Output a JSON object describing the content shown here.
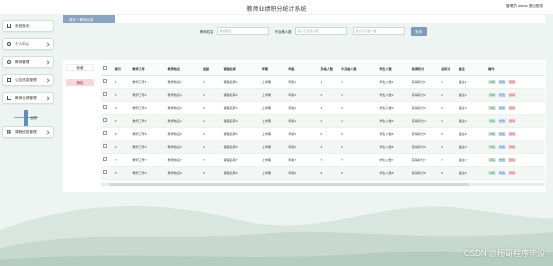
{
  "app": {
    "title": "教师业绩积分统计系统",
    "user_info": "管理员 admin  退出登录"
  },
  "sidebar": {
    "items": [
      {
        "label": "系统首页",
        "icon": "home-icon"
      },
      {
        "label": "个人中心",
        "icon": "user-icon"
      },
      {
        "label": "教师管理",
        "icon": "person-icon"
      },
      {
        "label": "公告信息管理",
        "icon": "book-icon"
      },
      {
        "label": "教师业绩管理",
        "icon": "chart-icon"
      },
      {
        "label": "课程信息管理",
        "icon": "grid-icon"
      }
    ],
    "slider_text": "业绩"
  },
  "breadcrumb": {
    "home": "首页",
    "current": "教师业绩"
  },
  "search": {
    "f1_label": "教师姓名",
    "f1_placeholder": "教师姓名",
    "f2_label": "不及格人数",
    "f2_placeholder": "最小不及格人数",
    "f3_placeholder": "最大不及格人数",
    "button": "查询"
  },
  "actions": {
    "add": "新增",
    "delete": "删除"
  },
  "table": {
    "headers": [
      "",
      "索引",
      "教师工号",
      "教师姓名",
      "班级",
      "课程名称",
      "学期",
      "年级",
      "及格人数",
      "不及格人数",
      "学生人数",
      "获得积分",
      "总积分",
      "备注",
      "操作"
    ],
    "row_actions": [
      "详情",
      "修改",
      "删除"
    ],
    "rows": [
      [
        "1",
        "教师工号1",
        "教师姓名1",
        "1",
        "课程名称1",
        "上学期",
        "年级1",
        "1",
        "1",
        "学生人数1",
        "获得积分1",
        "1",
        "备注1"
      ],
      [
        "2",
        "教师工号2",
        "教师姓名2",
        "2",
        "课程名称2",
        "上学期",
        "年级2",
        "2",
        "2",
        "学生人数2",
        "获得积分2",
        "2",
        "备注2"
      ],
      [
        "3",
        "教师工号3",
        "教师姓名3",
        "3",
        "课程名称3",
        "上学期",
        "年级3",
        "3",
        "3",
        "学生人数3",
        "获得积分3",
        "3",
        "备注3"
      ],
      [
        "4",
        "教师工号4",
        "教师姓名4",
        "4",
        "课程名称4",
        "上学期",
        "年级4",
        "4",
        "4",
        "学生人数4",
        "获得积分4",
        "4",
        "备注4"
      ],
      [
        "5",
        "教师工号5",
        "教师姓名5",
        "5",
        "课程名称5",
        "上学期",
        "年级5",
        "5",
        "5",
        "学生人数5",
        "获得积分5",
        "5",
        "备注5"
      ],
      [
        "6",
        "教师工号6",
        "教师姓名6",
        "6",
        "课程名称6",
        "上学期",
        "年级6",
        "6",
        "6",
        "学生人数6",
        "获得积分6",
        "6",
        "备注6"
      ],
      [
        "7",
        "教师工号7",
        "教师姓名7",
        "7",
        "课程名称7",
        "上学期",
        "年级7",
        "7",
        "7",
        "学生人数7",
        "获得积分7",
        "7",
        "备注7"
      ],
      [
        "8",
        "教师工号8",
        "教师姓名8",
        "8",
        "课程名称8",
        "上学期",
        "年级8",
        "8",
        "8",
        "学生人数8",
        "获得积分8",
        "8",
        "备注8"
      ]
    ]
  },
  "watermark": "CSDN @杨哥程序毕设",
  "colors": {
    "accent": "#8aa3bf",
    "bg": "#eef4f1"
  }
}
